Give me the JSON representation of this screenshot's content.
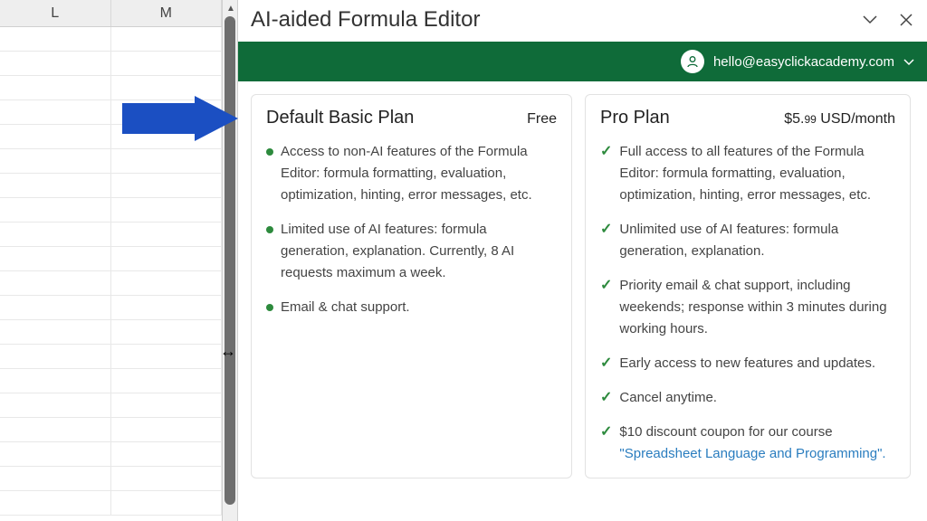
{
  "spreadsheet": {
    "columns": [
      "L",
      "M"
    ]
  },
  "panel": {
    "title": "AI-aided Formula Editor"
  },
  "user": {
    "email": "hello@easyclickacademy.com"
  },
  "plans": {
    "basic": {
      "name": "Default Basic Plan",
      "price": "Free",
      "features": [
        "Access to non-AI features of the Formula Editor: formula formatting, evaluation, optimization, hinting, error messages, etc.",
        "Limited use of AI features: formula generation, explanation. Currently, 8 AI requests maximum a week.",
        "Email & chat support."
      ]
    },
    "pro": {
      "name": "Pro Plan",
      "price_dollars": "$5.",
      "price_cents": "99",
      "price_suffix": " USD/month",
      "features": [
        "Full access to all features of the Formula Editor: formula formatting, evaluation, optimization, hinting, error messages, etc.",
        "Unlimited use of AI features: formula generation, explanation.",
        "Priority email & chat support, including weekends; response within 3 minutes during working hours.",
        "Early access to new features and updates.",
        "Cancel anytime."
      ],
      "course_feature_prefix": "$10 discount coupon for our course ",
      "course_link": "\"Spreadsheet Language and Programming\"."
    }
  }
}
